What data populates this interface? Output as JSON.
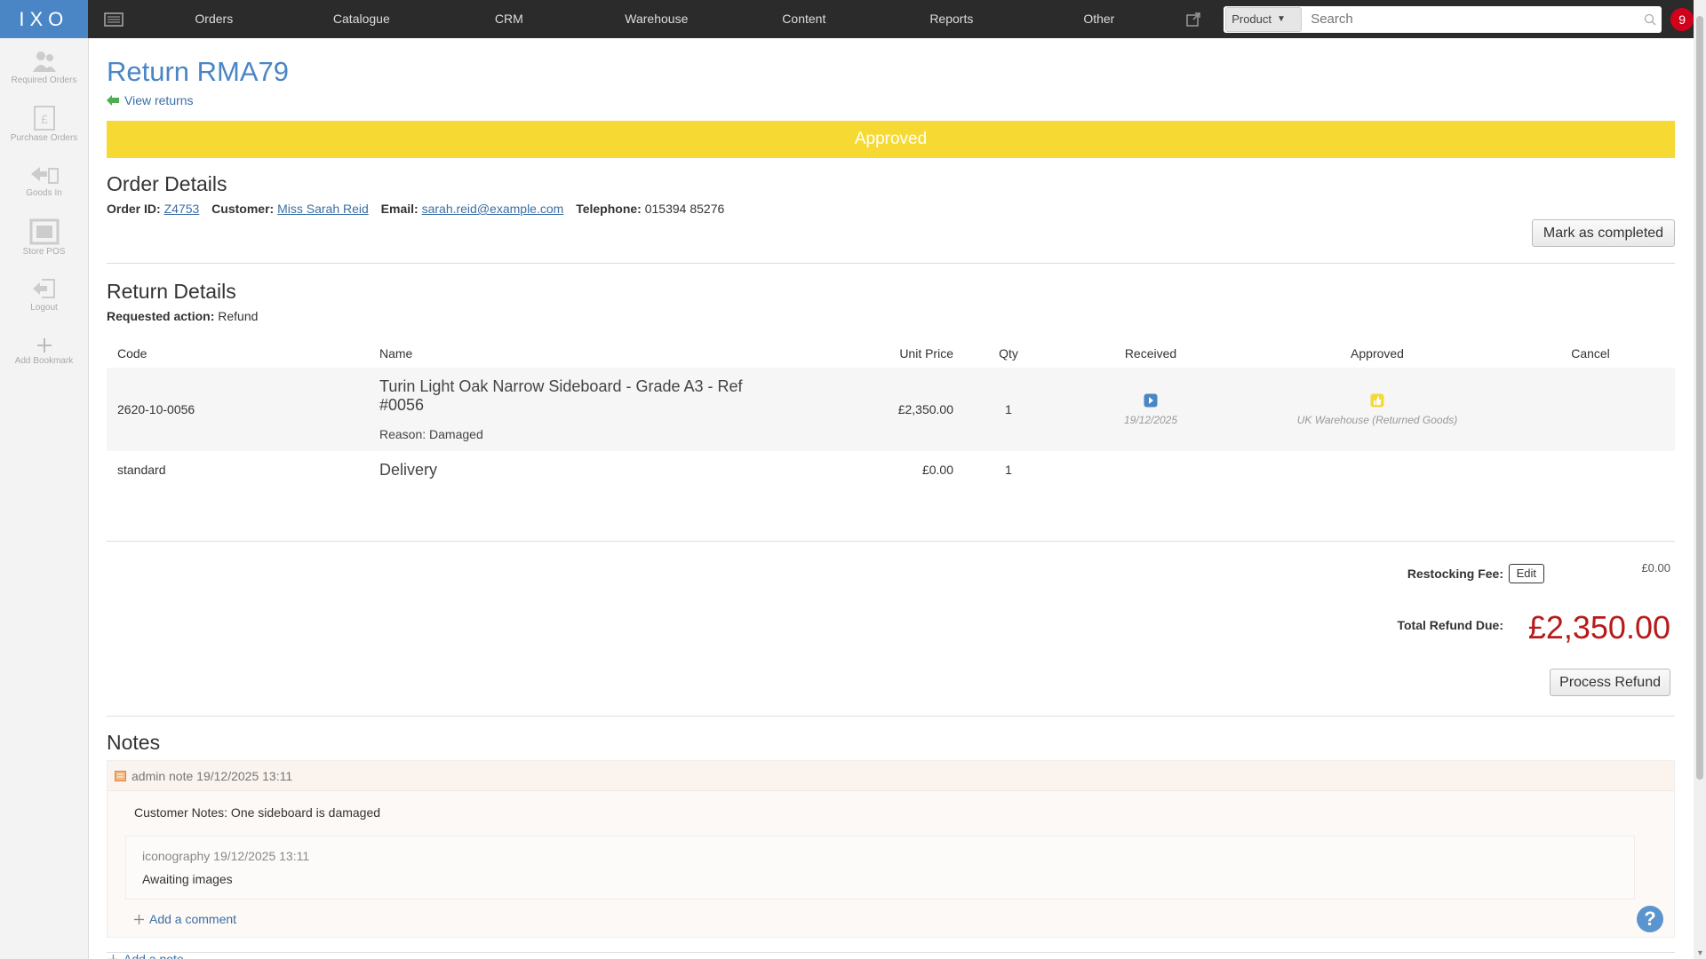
{
  "app": {
    "logo": "IXO"
  },
  "nav": [
    "Orders",
    "Catalogue",
    "CRM",
    "Warehouse",
    "Content",
    "Reports",
    "Other"
  ],
  "search": {
    "type": "Product",
    "placeholder": "Search"
  },
  "notifications": {
    "count": "9"
  },
  "sidebar": [
    {
      "label": "Required Orders",
      "icon": "users-icon"
    },
    {
      "label": "Purchase Orders",
      "icon": "pound-document-icon"
    },
    {
      "label": "Goods In",
      "icon": "goods-in-icon"
    },
    {
      "label": "Store POS",
      "icon": "store-pos-icon"
    },
    {
      "label": "Logout",
      "icon": "logout-icon"
    },
    {
      "label": "Add Bookmark",
      "icon": "plus-icon"
    }
  ],
  "page": {
    "title": "Return RMA79",
    "back_link": "View returns",
    "status": "Approved",
    "status_color": "#f7d934"
  },
  "order": {
    "heading": "Order Details",
    "order_id_label": "Order ID:",
    "order_id": "Z4753",
    "customer_label": "Customer:",
    "customer": "Miss Sarah Reid",
    "email_label": "Email:",
    "email": "sarah.reid@example.com",
    "telephone_label": "Telephone:",
    "telephone": "015394 85276",
    "mark_completed": "Mark as completed"
  },
  "returns": {
    "heading": "Return Details",
    "requested_action_label": "Requested action:",
    "requested_action": "Refund",
    "columns": [
      "Code",
      "Name",
      "Unit Price",
      "Qty",
      "Received",
      "Approved",
      "Cancel"
    ],
    "rows": [
      {
        "code": "2620-10-0056",
        "name": "Turin Light Oak Narrow Sideboard - Grade A3 - Ref #0056",
        "reason": "Reason: Damaged",
        "unit_price": "£2,350.00",
        "qty": "1",
        "received_date": "19/12/2025",
        "approved_location": "UK Warehouse (Returned Goods)"
      },
      {
        "code": "standard",
        "name": "Delivery",
        "unit_price": "£0.00",
        "qty": "1"
      }
    ]
  },
  "totals": {
    "restocking_label": "Restocking Fee:",
    "edit": "Edit",
    "restocking_value": "£0.00",
    "total_label": "Total Refund Due:",
    "total_value": "£2,350.00",
    "process_refund": "Process Refund"
  },
  "notes": {
    "heading": "Notes",
    "items": [
      {
        "author_time": "admin note 19/12/2025 13:11",
        "body": "Customer Notes: One sideboard is damaged",
        "comments": [
          {
            "author_time": "iconography 19/12/2025 13:11",
            "text": "Awaiting images"
          }
        ],
        "add_comment": "Add a comment"
      }
    ],
    "add_note": "Add a note"
  },
  "help": "?"
}
